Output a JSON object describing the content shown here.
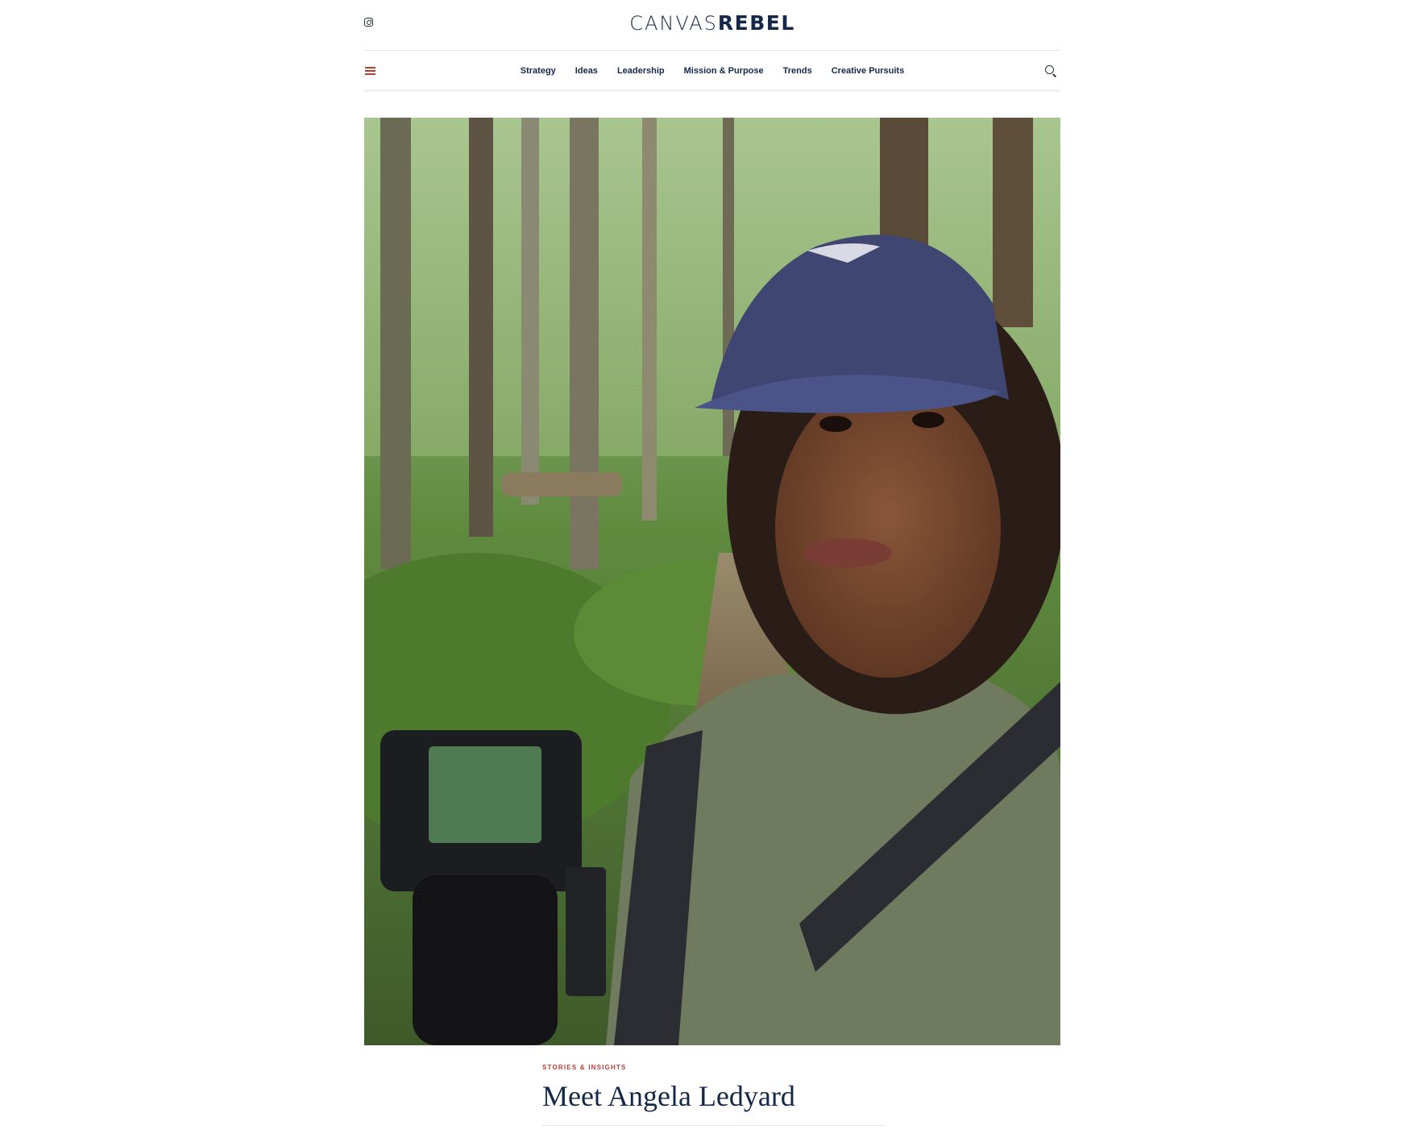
{
  "site": {
    "logo_light": "CANVAS",
    "logo_bold": "REBEL",
    "social_icon": "instagram-icon"
  },
  "nav": {
    "menu_icon": "hamburger-icon",
    "items": [
      {
        "label": "Strategy"
      },
      {
        "label": "Ideas"
      },
      {
        "label": "Leadership"
      },
      {
        "label": "Mission & Purpose"
      },
      {
        "label": "Trends"
      },
      {
        "label": "Creative Pursuits"
      }
    ],
    "search_icon": "search-icon"
  },
  "hero": {
    "description_icon": "photo"
  },
  "article": {
    "category": "STORIES & INSIGHTS",
    "title": "Meet Angela Ledyard"
  },
  "colors": {
    "accent": "#c23b2f",
    "brand_navy": "#14284a"
  }
}
